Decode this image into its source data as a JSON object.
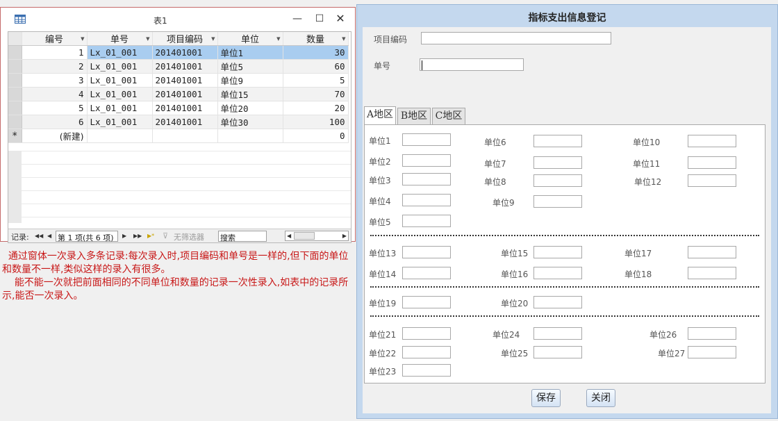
{
  "table_window": {
    "title": "表1",
    "controls": {
      "minimize": "—",
      "maximize": "☐",
      "close": "✕"
    },
    "columns": [
      "编号",
      "单号",
      "项目编码",
      "单位",
      "数量"
    ],
    "rows": [
      [
        "1",
        "Lx_01_001",
        "201401001",
        "单位1",
        "30"
      ],
      [
        "2",
        "Lx_01_001",
        "201401001",
        "单位5",
        "60"
      ],
      [
        "3",
        "Lx_01_001",
        "201401001",
        "单位9",
        "5"
      ],
      [
        "4",
        "Lx_01_001",
        "201401001",
        "单位15",
        "70"
      ],
      [
        "5",
        "Lx_01_001",
        "201401001",
        "单位20",
        "20"
      ],
      [
        "6",
        "Lx_01_001",
        "201401001",
        "单位30",
        "100"
      ]
    ],
    "new_row": {
      "marker": "*",
      "label": "(新建)",
      "qty": "0"
    },
    "navbar": {
      "label": "记录:",
      "first": "◀◀",
      "prev": "◀",
      "record": "第 1 项(共 6 项)",
      "next": "▶",
      "last": "▶▶",
      "new": "▶*",
      "filter": "无筛选器",
      "search": "搜索"
    }
  },
  "note": {
    "line1": "  通过窗体一次录入多条记录:每次录入时,项目编码和单号是一样的,但下面的单位和数量不一样,类似这样的录入有很多。",
    "line2": "    能不能一次就把前面相同的不同单位和数量的记录一次性录入,如表中的记录所示,能否一次录入。"
  },
  "form_window": {
    "title": "指标支出信息登记",
    "project_code_label": "项目编码",
    "order_no_label": "单号",
    "tabs": [
      "A地区",
      "B地区",
      "C地区"
    ],
    "units": {
      "u1": "单位1",
      "u2": "单位2",
      "u3": "单位3",
      "u4": "单位4",
      "u5": "单位5",
      "u6": "单位6",
      "u7": "单位7",
      "u8": "单位8",
      "u9": "单位9",
      "u10": "单位10",
      "u11": "单位11",
      "u12": "单位12",
      "u13": "单位13",
      "u14": "单位14",
      "u15": "单位15",
      "u16": "单位16",
      "u17": "单位17",
      "u18": "单位18",
      "u19": "单位19",
      "u20": "单位20",
      "u21": "单位21",
      "u22": "单位22",
      "u23": "单位23",
      "u24": "单位24",
      "u25": "单位25",
      "u26": "单位26",
      "u27": "单位27"
    },
    "save_label": "保存",
    "close_label": "关闭"
  }
}
